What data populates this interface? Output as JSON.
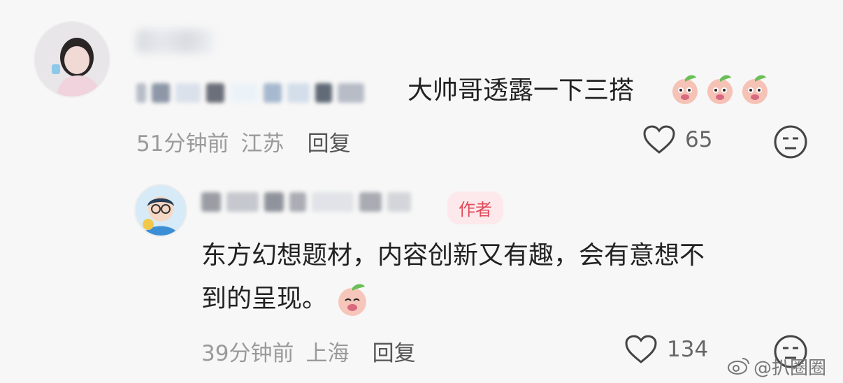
{
  "comment": {
    "text": "大帅哥透露一下三搭",
    "meta_time": "51分钟前",
    "meta_location": "江苏",
    "reply_label": "回复",
    "like_count": "65"
  },
  "reply": {
    "author_badge": "作者",
    "text_line1": "东方幻想题材，内容创新又有趣，会有意想不",
    "text_line2": "到的呈现。",
    "meta_time": "39分钟前",
    "meta_location": "上海",
    "reply_label": "回复",
    "like_count": "134"
  },
  "watermark": "@扒圈圈",
  "icons": {
    "like": "heart-icon",
    "dislike": "neutral-face-icon",
    "emoji": "peach-emoji-icon",
    "weibo": "weibo-logo-icon"
  }
}
